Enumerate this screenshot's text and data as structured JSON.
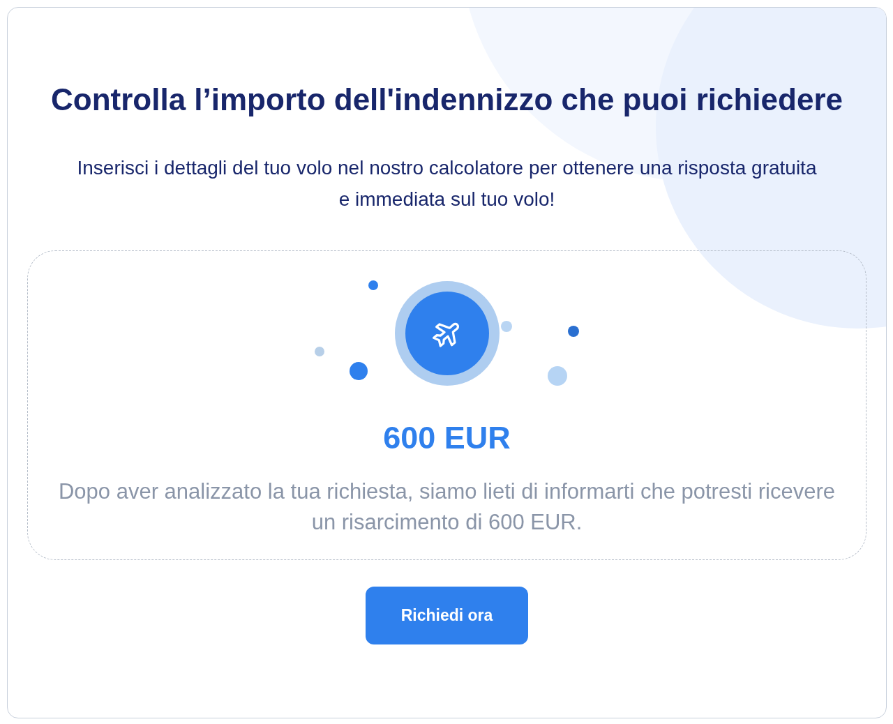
{
  "card": {
    "title": "Controlla l’importo dell'indennizzo che puoi richiedere",
    "subtitle": "Inserisci i dettagli del tuo volo nel nostro calcolatore per ottenere una risposta gratuita e immediata sul tuo volo!"
  },
  "result": {
    "amount": "600 EUR",
    "message": "Dopo aver analizzato la tua richiesta, siamo lieti di informarti che potresti ricevere un risarcimento di 600 EUR."
  },
  "button": {
    "label": "Richiedi ora"
  }
}
